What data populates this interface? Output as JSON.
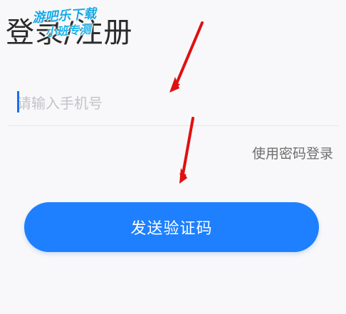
{
  "header": {
    "title": "登录/注册"
  },
  "watermark": {
    "line1": "游吧乐下载",
    "line2": "小班专测"
  },
  "phone": {
    "placeholder": "请输入手机号",
    "value": ""
  },
  "links": {
    "password_login": "使用密码登录"
  },
  "actions": {
    "send_code_label": "发送验证码"
  },
  "colors": {
    "accent": "#1e80ff",
    "annotation_arrow": "#e01010"
  },
  "icons": {
    "annotation": "arrow-pointer-icon"
  }
}
